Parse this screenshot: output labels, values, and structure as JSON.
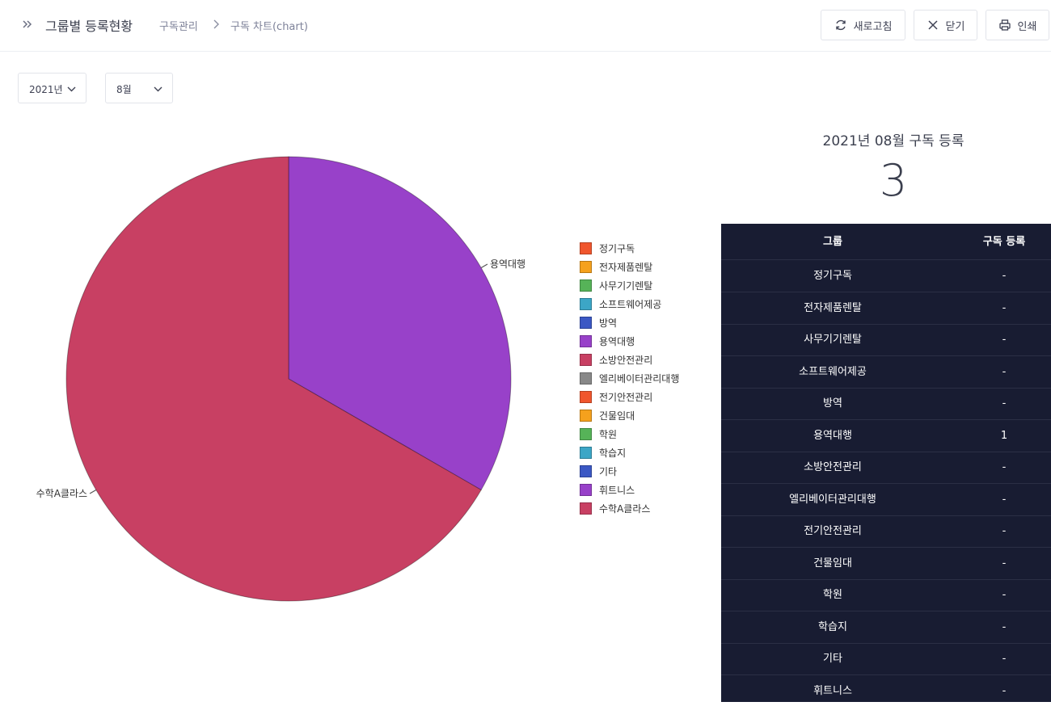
{
  "header": {
    "title": "그룹별 등록현황",
    "breadcrumb": [
      "구독관리",
      "구독 차트(chart)"
    ],
    "buttons": {
      "refresh": "새로고침",
      "close": "닫기",
      "print": "인쇄"
    }
  },
  "filters": {
    "year": "2021년",
    "month": "8월"
  },
  "summary": {
    "title": "2021년 08월 구독 등록",
    "value": "3"
  },
  "chart_data": {
    "type": "pie",
    "categories": [
      "정기구독",
      "전자제품렌탈",
      "사무기기렌탈",
      "소프트웨어제공",
      "방역",
      "용역대행",
      "소방안전관리",
      "엘리베이터관리대행",
      "전기안전관리",
      "건물임대",
      "학원",
      "학습지",
      "기타",
      "휘트니스",
      "수학A클라스"
    ],
    "values": [
      0,
      0,
      0,
      0,
      0,
      1,
      0,
      0,
      0,
      0,
      0,
      0,
      0,
      0,
      2
    ],
    "colors": [
      "#f0562d",
      "#f5a11d",
      "#56b358",
      "#3ca6c6",
      "#3b58c4",
      "#9841c9",
      "#c84063",
      "#888888",
      "#f0562d",
      "#f5a11d",
      "#56b358",
      "#3ca6c6",
      "#3b58c4",
      "#9841c9",
      "#c84063"
    ],
    "slice_labels": [
      "용역대행",
      "수학A클라스"
    ],
    "legend_position": "right"
  },
  "table": {
    "columns": [
      "그룹",
      "구독 등록"
    ],
    "rows": [
      [
        "정기구독",
        "-"
      ],
      [
        "전자제품렌탈",
        "-"
      ],
      [
        "사무기기렌탈",
        "-"
      ],
      [
        "소프트웨어제공",
        "-"
      ],
      [
        "방역",
        "-"
      ],
      [
        "용역대행",
        "1"
      ],
      [
        "소방안전관리",
        "-"
      ],
      [
        "엘리베이터관리대행",
        "-"
      ],
      [
        "전기안전관리",
        "-"
      ],
      [
        "건물임대",
        "-"
      ],
      [
        "학원",
        "-"
      ],
      [
        "학습지",
        "-"
      ],
      [
        "기타",
        "-"
      ],
      [
        "휘트니스",
        "-"
      ]
    ]
  }
}
